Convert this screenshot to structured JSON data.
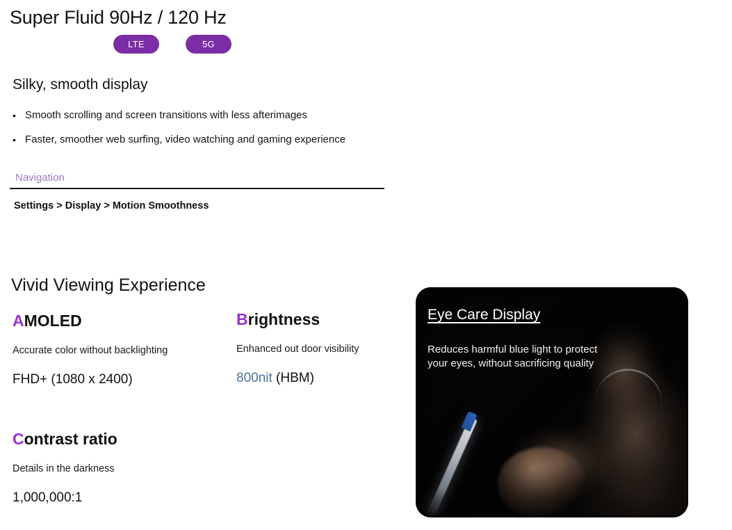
{
  "slide": {
    "background_color": "#ffffff",
    "accent_purple": "#9933CC",
    "badge_purple": "#7B2DA6",
    "nav_label_purple": "#9B7BC0",
    "value_blue": "#4A7296"
  },
  "section_fluid": {
    "title": "Super Fluid 90Hz / 120 Hz",
    "badges": [
      {
        "label": "LTE"
      },
      {
        "label": "5G"
      }
    ],
    "subheading": "Silky, smooth display",
    "bullet_marker": "•",
    "bullets": [
      "Smooth scrolling and screen transitions with less afterimages",
      "Faster, smoother web surfing, video watching and gaming experience"
    ],
    "navigation": {
      "label": "Navigation",
      "breadcrumb": "Settings > Display > Motion Smoothness"
    }
  },
  "section_vivid": {
    "title": "Vivid Viewing Experience",
    "specs": [
      {
        "accent_letter": "A",
        "heading_rest": "MOLED",
        "description": "Accurate color without backlighting",
        "value_plain": "FHD+ (1080 x 2400)",
        "value_highlight": "",
        "value_suffix": ""
      },
      {
        "accent_letter": "B",
        "heading_rest": "rightness",
        "description": "Enhanced out door visibility",
        "value_plain": "",
        "value_highlight": "800nit",
        "value_suffix": " (HBM)"
      },
      {
        "accent_letter": "C",
        "heading_rest": "ontrast ratio",
        "description": "Details in the darkness",
        "value_plain": "1,000,000:1",
        "value_highlight": "",
        "value_suffix": ""
      }
    ]
  },
  "photo_panel": {
    "heading": "Eye Care Display",
    "body": "Reduces harmful blue light to protect your eyes, without sacrificing quality"
  }
}
